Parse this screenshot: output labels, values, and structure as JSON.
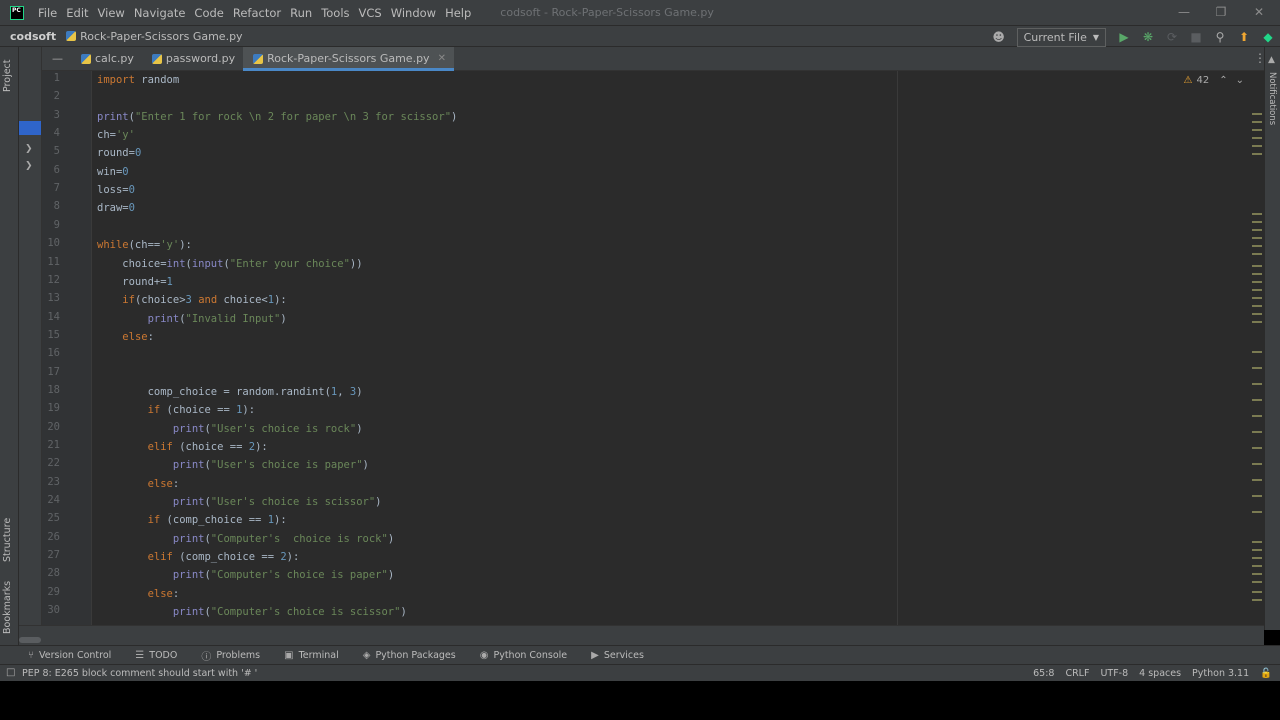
{
  "menubar": {
    "items": [
      "File",
      "Edit",
      "View",
      "Navigate",
      "Code",
      "Refactor",
      "Run",
      "Tools",
      "VCS",
      "Window",
      "Help"
    ],
    "window_title": "codsoft - Rock-Paper-Scissors Game.py"
  },
  "navbar": {
    "project": "codsoft",
    "file": "Rock-Paper-Scissors Game.py",
    "run_config": "Current File"
  },
  "left_strip": {
    "project_label": "Project",
    "structure_label": "Structure",
    "bookmarks_label": "Bookmarks"
  },
  "tabs": [
    {
      "label": "calc.py"
    },
    {
      "label": "password.py"
    },
    {
      "label": "Rock-Paper-Scissors Game.py",
      "active": true
    }
  ],
  "editor": {
    "warning_count": "42",
    "lines": [
      "import random",
      "",
      "print(\"Enter 1 for rock \\n 2 for paper \\n 3 for scissor\")",
      "ch='y'",
      "round=0",
      "win=0",
      "loss=0",
      "draw=0",
      "",
      "while(ch=='y'):",
      "    choice=int(input(\"Enter your choice\"))",
      "    round+=1",
      "    if(choice>3 and choice<1):",
      "        print(\"Invalid Input\")",
      "    else:",
      "",
      "",
      "        comp_choice = random.randint(1, 3)",
      "        if (choice == 1):",
      "            print(\"User's choice is rock\")",
      "        elif (choice == 2):",
      "            print(\"User's choice is paper\")",
      "        else:",
      "            print(\"User's choice is scissor\")",
      "        if (comp_choice == 1):",
      "            print(\"Computer's  choice is rock\")",
      "        elif (comp_choice == 2):",
      "            print(\"Computer's choice is paper\")",
      "        else:",
      "            print(\"Computer's choice is scissor\")"
    ]
  },
  "right_strip": {
    "notifications_label": "Notifications"
  },
  "bottom_tools": [
    {
      "label": "Version Control",
      "icon": "branch-icon"
    },
    {
      "label": "TODO",
      "icon": "list-icon"
    },
    {
      "label": "Problems",
      "icon": "info-icon"
    },
    {
      "label": "Terminal",
      "icon": "terminal-icon"
    },
    {
      "label": "Python Packages",
      "icon": "packages-icon"
    },
    {
      "label": "Python Console",
      "icon": "console-icon"
    },
    {
      "label": "Services",
      "icon": "services-icon"
    }
  ],
  "statusbar": {
    "message": "PEP 8: E265 block comment should start with '# '",
    "position": "65:8",
    "line_sep": "CRLF",
    "encoding": "UTF-8",
    "indent": "4 spaces",
    "interpreter": "Python 3.11"
  },
  "colors": {
    "keyword": "#cc7832",
    "string": "#6a8759",
    "number": "#6897bb",
    "builtin": "#8888c6",
    "text": "#a9b7c6",
    "editor_bg": "#2b2b2b",
    "chrome_bg": "#3c3f41"
  }
}
